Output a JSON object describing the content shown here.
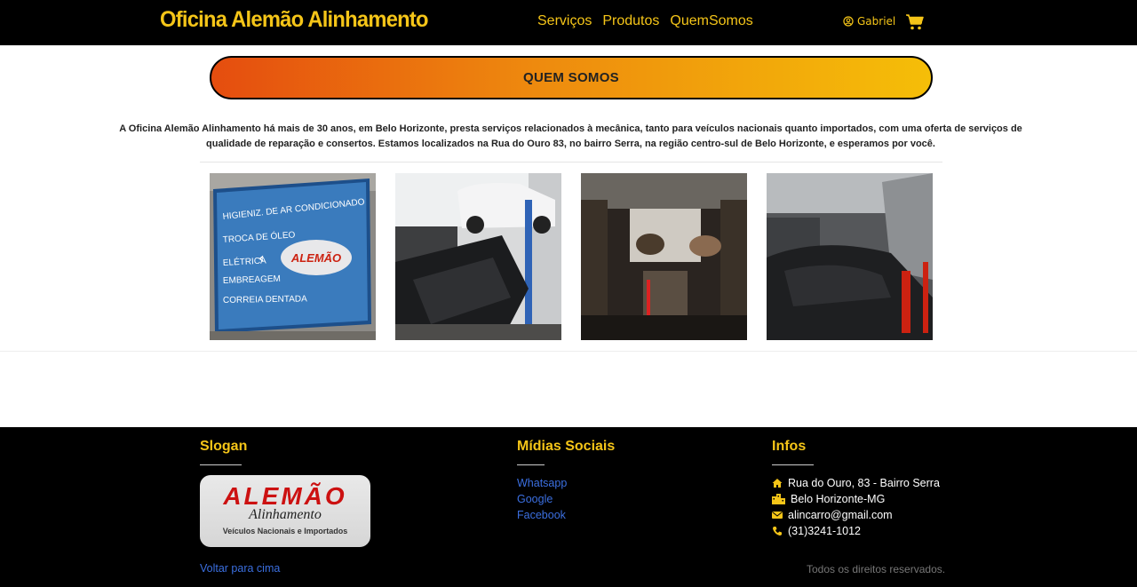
{
  "navbar": {
    "brand": "Oficina Alemão Alinhamento",
    "links": [
      "Serviços",
      "Produtos",
      "QuemSomos"
    ],
    "user": "Gabriel",
    "icons": {
      "user": "user-circle-icon",
      "cart": "shopping-cart-icon"
    },
    "colors": {
      "accent": "#f5c518",
      "background": "#000000"
    }
  },
  "hero": {
    "title": "QUEM SOMOS",
    "description": "A Oficina Alemão Alinhamento há mais de 30 anos, em Belo Horizonte, presta serviços relacionados à mecânica, tanto para veículos nacionais quanto importados, com uma oferta de serviços de qualidade de reparação e consertos. Estamos localizados na Rua do Ouro 83, no bairro Serra, na região centro-sul de Belo Horizonte, e esperamos por você."
  },
  "gallery": {
    "images": [
      "shop-sign",
      "car-lift-workshop",
      "workshop-aisle",
      "workshop-cars"
    ],
    "sign_lines": [
      "HIGIENIZ. DE AR CONDICIONADO",
      "TROCA DE ÓLEO",
      "ELÉTRICA",
      "EMBREAGEM",
      "CORREIA DENTADA"
    ],
    "sign_logo": "ALEMÃO",
    "prev_icon": "chevron-left-icon"
  },
  "footer": {
    "slogan_title": "Slogan",
    "logo": {
      "line1": "ALEMÃO",
      "line2": "Alinhamento",
      "line3": "Veículos Nacionais e Importados"
    },
    "back_to_top": "Voltar para cima",
    "social_title": "Mídias Sociais",
    "social_links": [
      "Whatsapp",
      "Google",
      "Facebook"
    ],
    "info_title": "Infos",
    "info": [
      {
        "icon": "home-icon",
        "text": "Rua do Ouro, 83 - Bairro Serra"
      },
      {
        "icon": "city-icon",
        "text": "Belo Horizonte-MG"
      },
      {
        "icon": "envelope-icon",
        "text": "alincarro@gmail.com"
      },
      {
        "icon": "phone-icon",
        "text": "(31)3241-1012"
      }
    ],
    "rights": "Todos os direitos reservados."
  }
}
